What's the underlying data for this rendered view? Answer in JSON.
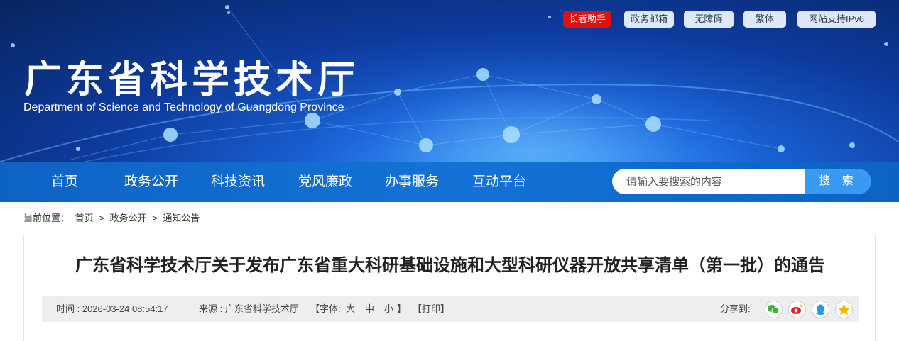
{
  "header": {
    "title": "广东省科学技术厅",
    "subtitle": "Department of Science and Technology of Guangdong Province",
    "tools": [
      "长者助手",
      "政务邮箱",
      "无障碍",
      "繁体",
      "网站支持IPv6"
    ]
  },
  "nav": {
    "items": [
      "首页",
      "政务公开",
      "科技资讯",
      "党风廉政",
      "办事服务",
      "互动平台"
    ],
    "search_placeholder": "请输入要搜索的内容",
    "search_button": "搜 索"
  },
  "breadcrumb": {
    "prefix": "当前位置：",
    "items": [
      "首页",
      "政务公开",
      "通知公告"
    ],
    "separator": ">"
  },
  "article": {
    "title": "广东省科学技术厅关于发布广东省重大科研基础设施和大型科研仪器开放共享清单（第一批）的通告",
    "time": "时间 : 2026-03-24 08:54:17",
    "source": "来源 : 广东省科学技术厅",
    "font_label": "【字体:",
    "font_large": "大",
    "font_medium": "中",
    "font_small": "小",
    "font_close": "】",
    "print": "【打印】",
    "share_label": "分享到:",
    "share_icons": [
      "wechat-icon",
      "weibo-icon",
      "qq-icon",
      "qzone-icon"
    ]
  },
  "colors": {
    "nav_bg": "#1472d6",
    "search_button": "#3a9af2",
    "elder_button": "#e01010"
  }
}
